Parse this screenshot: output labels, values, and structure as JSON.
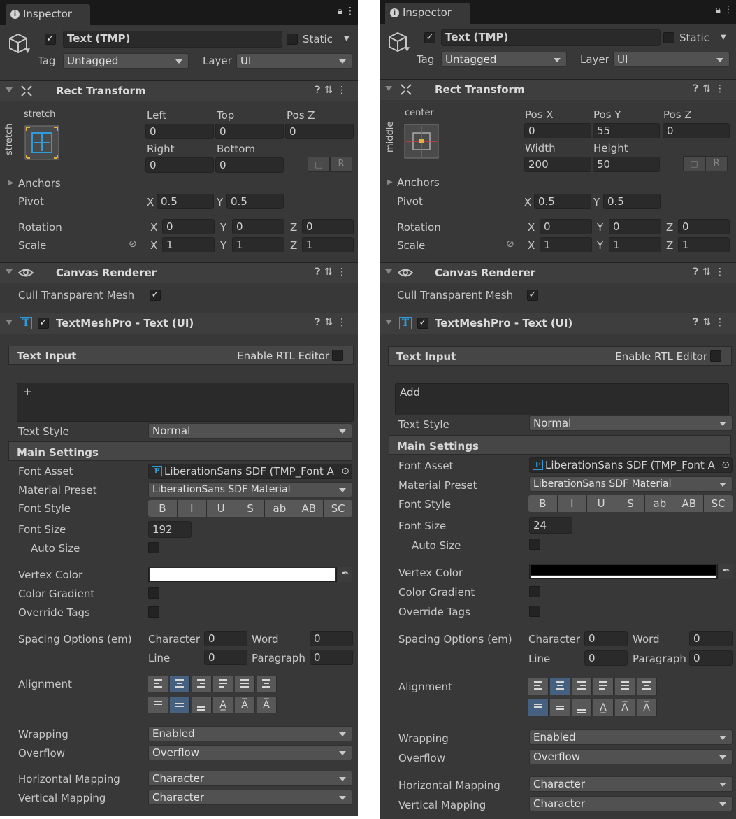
{
  "panels": [
    {
      "tab": "Inspector",
      "object_name": "Text (TMP)",
      "static_label": "Static",
      "tag_label": "Tag",
      "tag_value": "Untagged",
      "layer_label": "Layer",
      "layer_value": "UI",
      "rect": {
        "title": "Rect Transform",
        "anchor_h": "stretch",
        "anchor_v": "stretch",
        "fields": [
          {
            "label": "Left",
            "value": "0"
          },
          {
            "label": "Top",
            "value": "0"
          },
          {
            "label": "Pos Z",
            "value": "0"
          },
          {
            "label": "Right",
            "value": "0"
          },
          {
            "label": "Bottom",
            "value": "0"
          }
        ],
        "r_btn": "R",
        "anchors_label": "Anchors",
        "pivot_label": "Pivot",
        "pivot_x": "0.5",
        "pivot_y": "0.5",
        "rotation_label": "Rotation",
        "rotation": [
          "0",
          "0",
          "0"
        ],
        "scale_label": "Scale",
        "scale": [
          "1",
          "1",
          "1"
        ],
        "axis": [
          "X",
          "Y",
          "Z"
        ]
      },
      "canvas": {
        "title": "Canvas Renderer",
        "cull_label": "Cull Transparent Mesh"
      },
      "tmp": {
        "title": "TextMeshPro - Text (UI)",
        "text_input_label": "Text Input",
        "rtl_label": "Enable RTL Editor",
        "text_value": "+",
        "text_style_label": "Text Style",
        "text_style_value": "Normal",
        "main_settings_label": "Main Settings",
        "font_asset_label": "Font Asset",
        "font_asset_value": "LiberationSans SDF (TMP_Font A",
        "material_preset_label": "Material Preset",
        "material_preset_value": "LiberationSans SDF Material",
        "font_style_label": "Font Style",
        "font_style_buttons": [
          "B",
          "I",
          "U",
          "S",
          "ab",
          "AB",
          "SC"
        ],
        "font_size_label": "Font Size",
        "font_size_value": "192",
        "auto_size_label": "Auto Size",
        "vertex_color_label": "Vertex Color",
        "vertex_color": "#ffffff",
        "color_gradient_label": "Color Gradient",
        "override_tags_label": "Override Tags",
        "spacing_label": "Spacing Options (em)",
        "character_label": "Character",
        "character_value": "0",
        "word_label": "Word",
        "word_value": "0",
        "line_label": "Line",
        "line_value": "0",
        "paragraph_label": "Paragraph",
        "paragraph_value": "0",
        "alignment_label": "Alignment",
        "wrapping_label": "Wrapping",
        "wrapping_value": "Enabled",
        "overflow_label": "Overflow",
        "overflow_value": "Overflow",
        "h_mapping_label": "Horizontal Mapping",
        "h_mapping_value": "Character",
        "v_mapping_label": "Vertical Mapping",
        "v_mapping_value": "Character"
      }
    },
    {
      "tab": "Inspector",
      "object_name": "Text (TMP)",
      "static_label": "Static",
      "tag_label": "Tag",
      "tag_value": "Untagged",
      "layer_label": "Layer",
      "layer_value": "UI",
      "rect": {
        "title": "Rect Transform",
        "anchor_h": "center",
        "anchor_v": "middle",
        "fields": [
          {
            "label": "Pos X",
            "value": "0"
          },
          {
            "label": "Pos Y",
            "value": "55"
          },
          {
            "label": "Pos Z",
            "value": "0"
          },
          {
            "label": "Width",
            "value": "200"
          },
          {
            "label": "Height",
            "value": "50"
          }
        ],
        "r_btn": "R",
        "anchors_label": "Anchors",
        "pivot_label": "Pivot",
        "pivot_x": "0.5",
        "pivot_y": "0.5",
        "rotation_label": "Rotation",
        "rotation": [
          "0",
          "0",
          "0"
        ],
        "scale_label": "Scale",
        "scale": [
          "1",
          "1",
          "1"
        ],
        "axis": [
          "X",
          "Y",
          "Z"
        ]
      },
      "canvas": {
        "title": "Canvas Renderer",
        "cull_label": "Cull Transparent Mesh"
      },
      "tmp": {
        "title": "TextMeshPro - Text (UI)",
        "text_input_label": "Text Input",
        "rtl_label": "Enable RTL Editor",
        "text_value": "Add",
        "text_style_label": "Text Style",
        "text_style_value": "Normal",
        "main_settings_label": "Main Settings",
        "font_asset_label": "Font Asset",
        "font_asset_value": "LiberationSans SDF (TMP_Font A",
        "material_preset_label": "Material Preset",
        "material_preset_value": "LiberationSans SDF Material",
        "font_style_label": "Font Style",
        "font_style_buttons": [
          "B",
          "I",
          "U",
          "S",
          "ab",
          "AB",
          "SC"
        ],
        "font_size_label": "Font Size",
        "font_size_value": "24",
        "auto_size_label": "Auto Size",
        "vertex_color_label": "Vertex Color",
        "vertex_color": "#000000",
        "color_gradient_label": "Color Gradient",
        "override_tags_label": "Override Tags",
        "spacing_label": "Spacing Options (em)",
        "character_label": "Character",
        "character_value": "0",
        "word_label": "Word",
        "word_value": "0",
        "line_label": "Line",
        "line_value": "0",
        "paragraph_label": "Paragraph",
        "paragraph_value": "0",
        "alignment_label": "Alignment",
        "wrapping_label": "Wrapping",
        "wrapping_value": "Enabled",
        "overflow_label": "Overflow",
        "overflow_value": "Overflow",
        "h_mapping_label": "Horizontal Mapping",
        "h_mapping_value": "Character",
        "v_mapping_label": "Vertical Mapping",
        "v_mapping_value": "Character"
      }
    }
  ],
  "colors": {
    "panel_bg": "#383838",
    "selected_button": "#46607f",
    "accent_cyan": "#2f9bd8"
  }
}
